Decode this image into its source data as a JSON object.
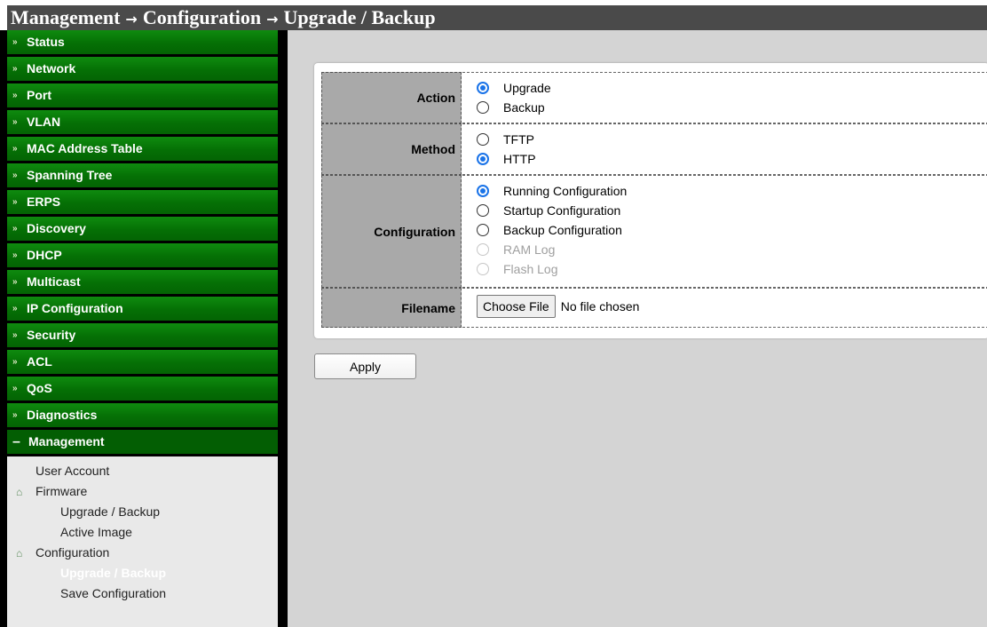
{
  "breadcrumb": [
    "Management",
    "Configuration",
    "Upgrade / Backup"
  ],
  "breadcrumb_separator": "→",
  "colors": {
    "nav_green": "#057005",
    "header_bg": "#4a4a4a",
    "label_bg": "#a9a9a9",
    "radio_accent": "#1a73e8",
    "content_bg": "#d4d4d4"
  },
  "sidebar": {
    "collapsed_bullet": "»",
    "expanded_bullet": "–",
    "items": [
      {
        "label": "Status"
      },
      {
        "label": "Network"
      },
      {
        "label": "Port"
      },
      {
        "label": "VLAN"
      },
      {
        "label": "MAC Address Table"
      },
      {
        "label": "Spanning Tree"
      },
      {
        "label": "ERPS"
      },
      {
        "label": "Discovery"
      },
      {
        "label": "DHCP"
      },
      {
        "label": "Multicast"
      },
      {
        "label": "IP Configuration"
      },
      {
        "label": "Security"
      },
      {
        "label": "ACL"
      },
      {
        "label": "QoS"
      },
      {
        "label": "Diagnostics"
      },
      {
        "label": "Management"
      }
    ],
    "management_sub": {
      "user_account": "User Account",
      "firmware": "Firmware",
      "fw_upgrade_backup": "Upgrade / Backup",
      "fw_active_image": "Active Image",
      "configuration": "Configuration",
      "cfg_upgrade_backup": "Upgrade / Backup",
      "cfg_save": "Save Configuration"
    }
  },
  "form": {
    "action": {
      "label": "Action",
      "options": [
        {
          "label": "Upgrade",
          "selected": true
        },
        {
          "label": "Backup",
          "selected": false
        }
      ]
    },
    "method": {
      "label": "Method",
      "options": [
        {
          "label": "TFTP",
          "selected": false
        },
        {
          "label": "HTTP",
          "selected": true
        }
      ]
    },
    "configuration": {
      "label": "Configuration",
      "options": [
        {
          "label": "Running Configuration",
          "selected": true,
          "disabled": false
        },
        {
          "label": "Startup Configuration",
          "selected": false,
          "disabled": false
        },
        {
          "label": "Backup Configuration",
          "selected": false,
          "disabled": false
        },
        {
          "label": "RAM Log",
          "selected": false,
          "disabled": true
        },
        {
          "label": "Flash Log",
          "selected": false,
          "disabled": true
        }
      ]
    },
    "filename": {
      "label": "Filename",
      "button_label": "Choose File",
      "status": "No file chosen"
    }
  },
  "apply_label": "Apply"
}
